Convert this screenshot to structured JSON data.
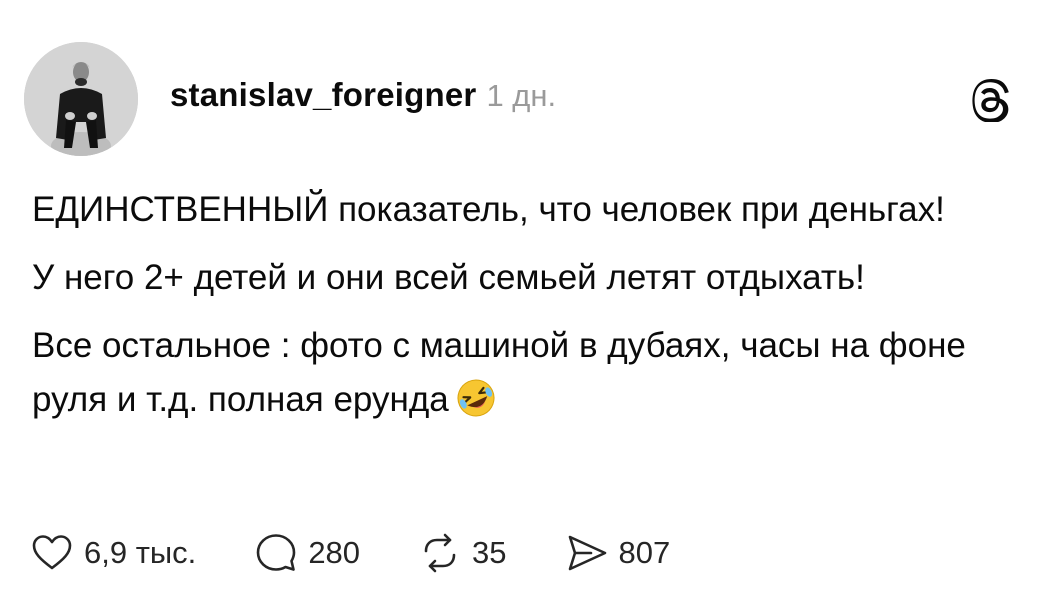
{
  "post": {
    "username": "stanislav_foreigner",
    "time": "1 дн.",
    "paragraphs": [
      "ЕДИНСТВЕННЫЙ показатель, что человек при деньгах!",
      "У него 2+ детей и они всей семьей летят отдыхать!",
      "Все остальное : фото с машиной в дубаях, часы на фоне руля и т.д. полная ерунда"
    ],
    "emoji": "rolling-on-the-floor-laughing-emoji"
  },
  "actions": {
    "likes": "6,9 тыс.",
    "replies": "280",
    "reposts": "35",
    "shares": "807"
  },
  "icons": {
    "app": "threads-logo-icon",
    "like": "heart-icon",
    "reply": "comment-bubble-icon",
    "repost": "repost-icon",
    "share": "send-icon"
  },
  "colors": {
    "text": "#0b0b0b",
    "muted": "#9a9a9a",
    "emoji_face": "#f7c631"
  }
}
